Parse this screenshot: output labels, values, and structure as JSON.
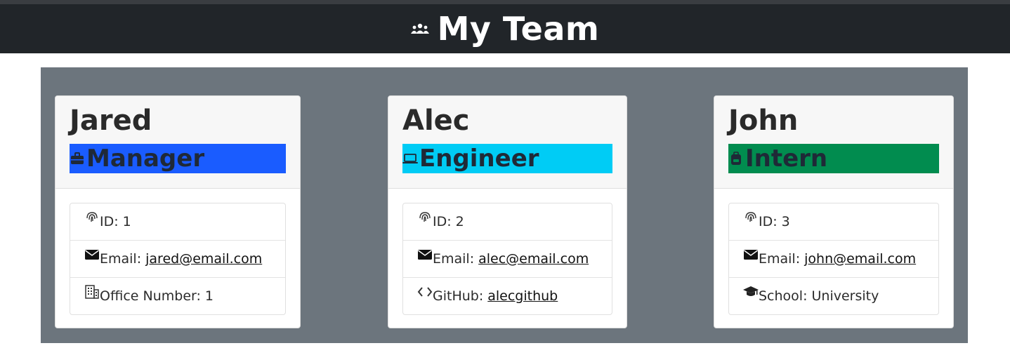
{
  "header": {
    "title": "My Team",
    "icon": "team-icon"
  },
  "colors": {
    "manager": "#1a5cff",
    "engineer": "#00ccf5",
    "intern": "#018c4f",
    "panel": "#6c757d",
    "header": "#212529"
  },
  "cards": [
    {
      "name": "Jared",
      "role": "Manager",
      "role_icon": "briefcase-icon",
      "id_label": "ID: 1",
      "email_label": "Email:",
      "email": "jared@email.com",
      "extra_label": "Office Number: 1",
      "extra_icon": "building-icon"
    },
    {
      "name": "Alec",
      "role": "Engineer",
      "role_icon": "laptop-icon",
      "id_label": "ID: 2",
      "email_label": "Email:",
      "email": "alec@email.com",
      "extra_label": "GitHub:",
      "extra_link": "alecgithub",
      "extra_icon": "code-icon"
    },
    {
      "name": "John",
      "role": "Intern",
      "role_icon": "backpack-icon",
      "id_label": "ID: 3",
      "email_label": "Email:",
      "email": "john@email.com",
      "extra_label": "School: University",
      "extra_icon": "graduation-cap-icon"
    }
  ]
}
